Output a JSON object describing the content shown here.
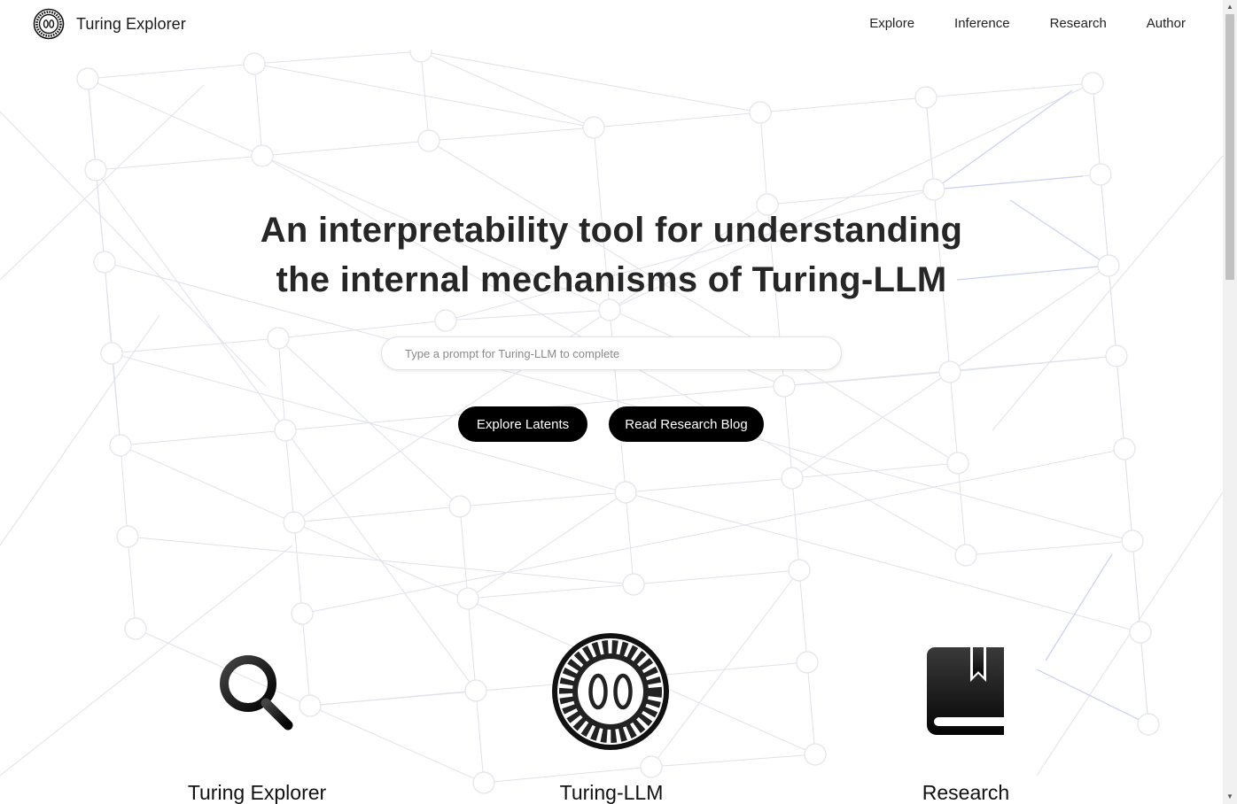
{
  "header": {
    "brand_name": "Turing Explorer",
    "logo_icon": "turing-gear-logo-icon",
    "nav": [
      {
        "label": "Explore"
      },
      {
        "label": "Inference"
      },
      {
        "label": "Research"
      },
      {
        "label": "Author"
      }
    ]
  },
  "hero": {
    "title_line1": "An interpretability tool for understanding",
    "title_line2": "the internal mechanisms of Turing-LLM",
    "search_placeholder": "Type a prompt for Turing-LLM to complete",
    "search_value": "",
    "explore_button": "Explore Latents",
    "blog_button": "Read Research Blog"
  },
  "features": [
    {
      "title": "Turing Explorer",
      "icon": "magnifier-icon"
    },
    {
      "title": "Turing-LLM",
      "icon": "turing-gear-icon"
    },
    {
      "title": "Research",
      "icon": "book-icon"
    }
  ],
  "colors": {
    "button_bg": "#000000",
    "button_text": "#ffffff",
    "network_line": "#dfe2ea",
    "network_line_accent": "#c9cff5"
  }
}
